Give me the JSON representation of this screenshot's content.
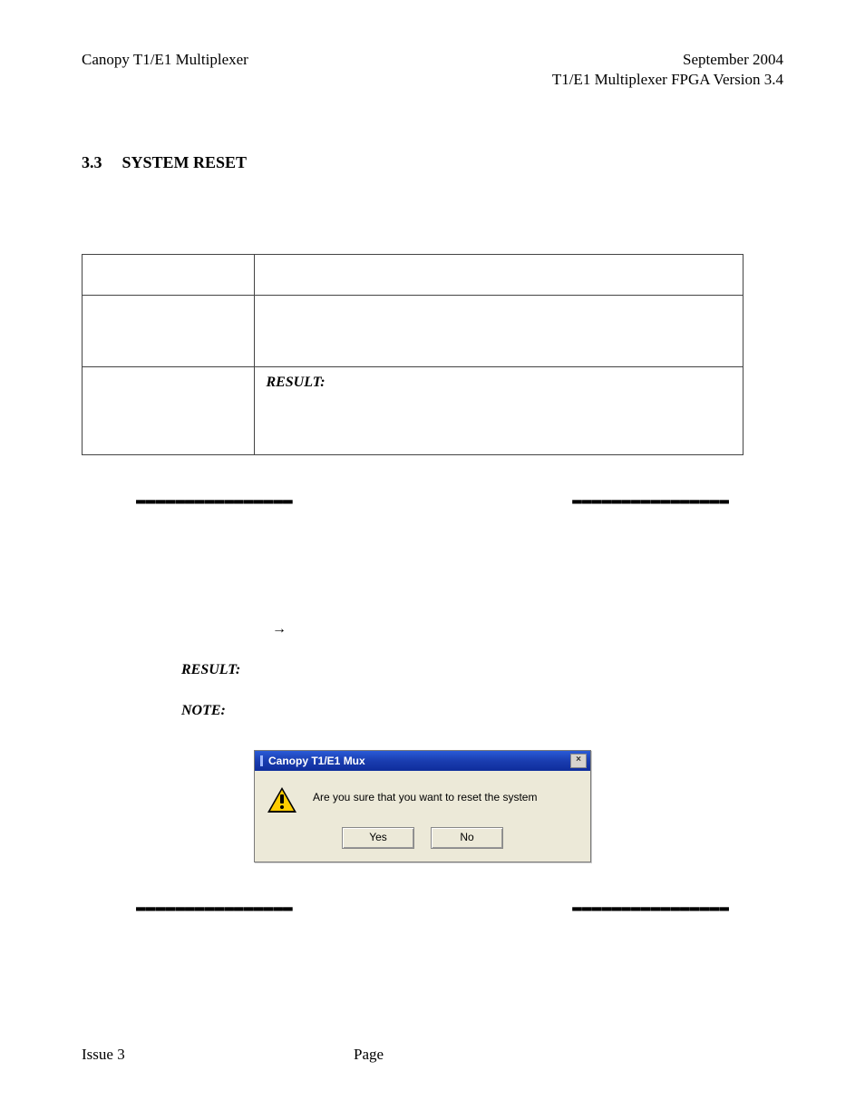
{
  "header": {
    "left": "Canopy T1/E1 Multiplexer",
    "right_line1": "September 2004",
    "right_line2": "T1/E1 Multiplexer FPGA Version 3.4"
  },
  "section": {
    "number": "3.3",
    "title": "SYSTEM RESET"
  },
  "table": {
    "result_label": "RESULT:"
  },
  "dashes": "▬▬▬▬▬▬▬▬▬▬▬▬▬▬▬▬",
  "midblock": {
    "arrow": "→",
    "result_label": "RESULT:",
    "note_label": "NOTE:"
  },
  "dialog": {
    "title": "Canopy T1/E1 Mux",
    "close": "×",
    "message": "Are you sure that you want to reset the system",
    "yes": "Yes",
    "no": "No"
  },
  "footer": {
    "left": "Issue 3",
    "center": "Page"
  }
}
